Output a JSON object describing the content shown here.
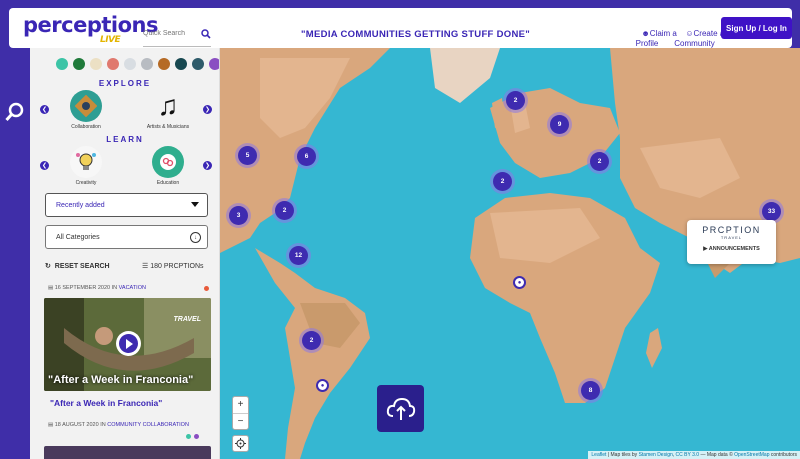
{
  "header": {
    "logo_main": "perceptions",
    "logo_sub": "LIVE",
    "search_placeholder": "Quick Search",
    "tagline": "\"MEDIA COMMUNITIES GETTING STUFF DONE\"",
    "claim_profile": "Claim a\nProfile",
    "create_community": "Create a\nCommunity",
    "signup": "Sign Up / Log In"
  },
  "sidebar": {
    "swatches": [
      "#3cc4a6",
      "#1f7a3a",
      "#ece0c4",
      "#e0796e",
      "#d8dde2",
      "#b8bcc2",
      "#b56a25",
      "#174850",
      "#2e5b6a",
      "#8a4ec2"
    ],
    "explore_title": "EXPLORE",
    "explore_items": [
      {
        "label": "Collaboration",
        "icon": "collaboration-icon"
      },
      {
        "label": "Artists & Musicians",
        "icon": "music-notes-icon"
      }
    ],
    "learn_title": "LEARN",
    "learn_items": [
      {
        "label": "Creativity",
        "icon": "lightbulb-icon"
      },
      {
        "label": "Education",
        "icon": "education-icon"
      }
    ],
    "sort_select": "Recently added",
    "category_select": "All Categories",
    "reset_label": "RESET SEARCH",
    "count_label": "180 PRCPTIONs",
    "post1": {
      "date": "16 SEPTEMBER 2020",
      "in": "IN",
      "category": "VACATION",
      "image_caption": "\"After a Week in Franconia\"",
      "watermark": "TRAVEL",
      "title": "\"After a Week in Franconia\""
    },
    "post2": {
      "date": "18 AUGUST 2020",
      "in": "IN",
      "category": "COMMUNITY COLLABORATION"
    }
  },
  "map": {
    "clusters": [
      {
        "label": "2"
      },
      {
        "label": "9"
      },
      {
        "label": "5"
      },
      {
        "label": "6"
      },
      {
        "label": "2"
      },
      {
        "label": "2"
      },
      {
        "label": "2"
      },
      {
        "label": "3"
      },
      {
        "label": "12"
      },
      {
        "label": "2"
      },
      {
        "label": "8"
      },
      {
        "label": "33"
      }
    ],
    "popup": {
      "brand": "PRCPTION",
      "sub": "TRAVEL",
      "announce": "ANNOUNCEMENTS"
    },
    "zoom_in": "+",
    "zoom_out": "−",
    "attribution_leaflet": "Leaflet",
    "attribution_text": "| Map tiles by",
    "attribution_stamen": "Stamen Design",
    "attribution_cc": "CC BY 3.0",
    "attribution_data": "— Map data ©",
    "attribution_osm": "OpenStreetMap",
    "attribution_tail": "contributors"
  }
}
